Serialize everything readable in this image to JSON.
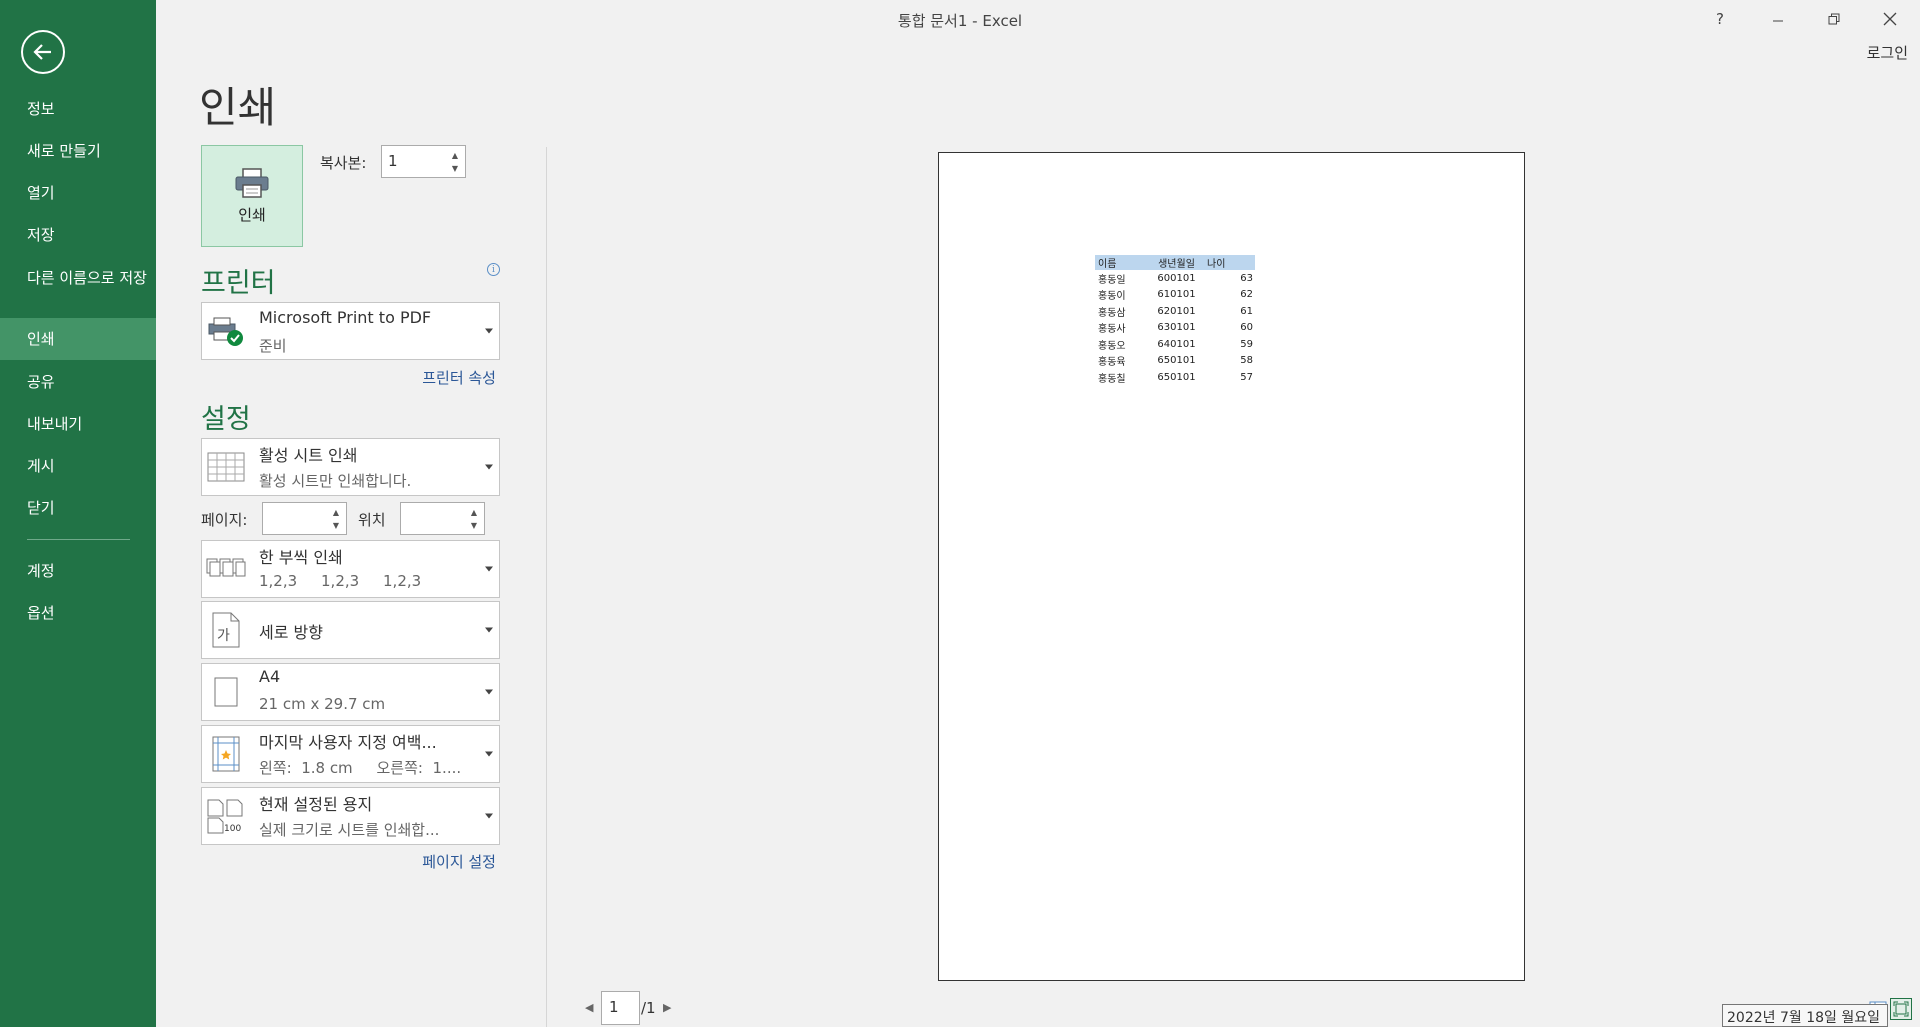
{
  "window": {
    "title": "통합 문서1 - Excel",
    "login": "로그인",
    "help": "?"
  },
  "nav": {
    "items": [
      "정보",
      "새로 만들기",
      "열기",
      "저장",
      "다른 이름으로 저장",
      "인쇄",
      "공유",
      "내보내기",
      "게시",
      "닫기",
      "계정",
      "옵션"
    ],
    "active": "인쇄"
  },
  "print": {
    "heading": "인쇄",
    "button_label": "인쇄",
    "copies_label": "복사본:",
    "copies_value": "1"
  },
  "printer": {
    "heading": "프린터",
    "name": "Microsoft Print to PDF",
    "status": "준비",
    "properties_link": "프린터 속성"
  },
  "settings": {
    "heading": "설정",
    "scope": {
      "title": "활성 시트 인쇄",
      "sub": "활성 시트만 인쇄합니다."
    },
    "pages_label": "페이지:",
    "pages_value": "",
    "to_label": "위치",
    "to_value": "",
    "collate": {
      "title": "한 부씩 인쇄",
      "sub": "1,2,3     1,2,3     1,2,3"
    },
    "orientation": {
      "title": "세로 방향"
    },
    "paper": {
      "title": "A4",
      "sub": "21 cm x 29.7 cm"
    },
    "margins": {
      "title": "마지막 사용자 지정 여백...",
      "sub": "왼쪽:  1.8 cm     오른쪽:  1...."
    },
    "scaling": {
      "title": "현재 설정된 용지",
      "sub": "실제 크기로 시트를 인쇄합..."
    },
    "page_setup_link": "페이지 설정"
  },
  "preview": {
    "headers": [
      "이름",
      "생년월일",
      "나이"
    ],
    "rows": [
      [
        "홍동일",
        "600101",
        "63"
      ],
      [
        "홍동이",
        "610101",
        "62"
      ],
      [
        "홍동삼",
        "620101",
        "61"
      ],
      [
        "홍동사",
        "630101",
        "60"
      ],
      [
        "홍동오",
        "640101",
        "59"
      ],
      [
        "홍동육",
        "650101",
        "58"
      ],
      [
        "홍동칠",
        "650101",
        "57"
      ]
    ],
    "current_page": "1",
    "total_pages": "/1"
  },
  "tooltip": {
    "date": "2022년 7월 18일 월요일"
  },
  "colors": {
    "nav_bg": "#217346",
    "nav_active": "#439467",
    "accent": "#217346",
    "link": "#2b5797",
    "header_fill": "#bcd6ee"
  }
}
